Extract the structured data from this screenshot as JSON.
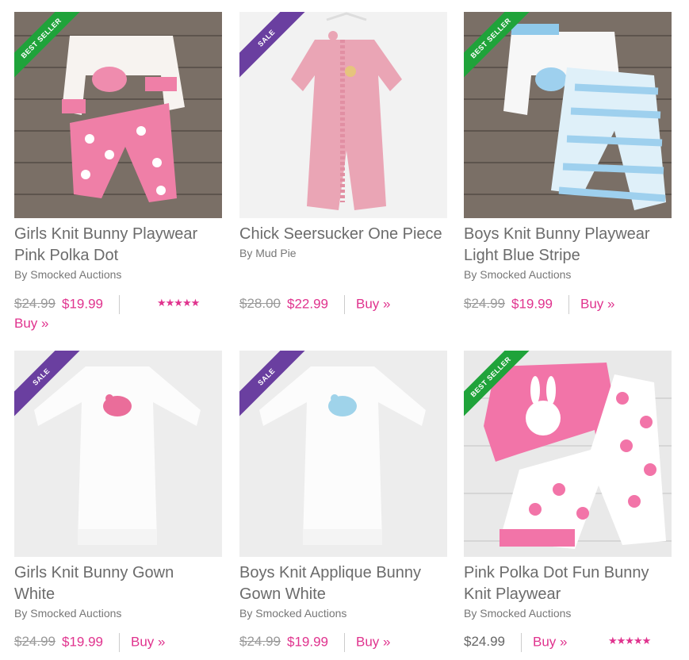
{
  "products": [
    {
      "title_line1": "Girls Knit Bunny Playwear",
      "title_line2": "Pink Polka Dot",
      "brand": "By Smocked Auctions",
      "old_price": "$24.99",
      "price": "$19.99",
      "buy": "Buy »",
      "ribbon": "BEST SELLER",
      "rating": "★★★★★"
    },
    {
      "title_line1": "Chick Seersucker One Piece",
      "title_line2": "",
      "brand": "By Mud Pie",
      "old_price": "$28.00",
      "price": "$22.99",
      "buy": "Buy »",
      "ribbon": "SALE"
    },
    {
      "title_line1": "Boys Knit Bunny Playwear",
      "title_line2": "Light Blue Stripe",
      "brand": "By Smocked Auctions",
      "old_price": "$24.99",
      "price": "$19.99",
      "buy": "Buy »",
      "ribbon": "BEST SELLER"
    },
    {
      "title_line1": "Girls Knit Bunny Gown",
      "title_line2": "White",
      "brand": "By Smocked Auctions",
      "old_price": "$24.99",
      "price": "$19.99",
      "buy": "Buy »",
      "ribbon": "SALE"
    },
    {
      "title_line1": "Boys Knit Applique Bunny",
      "title_line2": "Gown White",
      "brand": "By Smocked Auctions",
      "old_price": "$24.99",
      "price": "$19.99",
      "buy": "Buy »",
      "ribbon": "SALE"
    },
    {
      "title_line1": "Pink Polka Dot Fun Bunny",
      "title_line2": "Knit Playwear",
      "brand": "By Smocked Auctions",
      "old_price": "",
      "price": "$24.99",
      "buy": "Buy »",
      "ribbon": "BEST SELLER",
      "rating": "★★★★★"
    }
  ],
  "colors": {
    "accent": "#e0338e",
    "best_seller": "#1fa33a",
    "sale": "#6a3fa0"
  }
}
